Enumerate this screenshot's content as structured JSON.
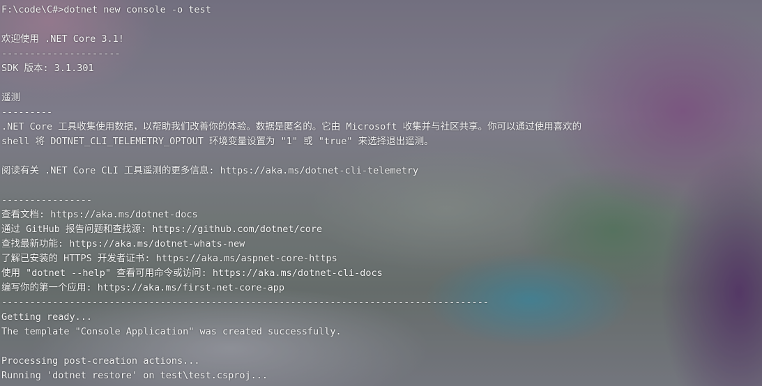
{
  "terminal": {
    "lines": [
      "F:\\code\\C#>dotnet new console -o test",
      "",
      "欢迎使用 .NET Core 3.1!",
      "---------------------",
      "SDK 版本: 3.1.301",
      "",
      "遥测",
      "---------",
      ".NET Core 工具收集使用数据，以帮助我们改善你的体验。数据是匿名的。它由 Microsoft 收集并与社区共享。你可以通过使用喜欢的",
      "shell 将 DOTNET_CLI_TELEMETRY_OPTOUT 环境变量设置为 \"1\" 或 \"true\" 来选择退出遥测。",
      "",
      "阅读有关 .NET Core CLI 工具遥测的更多信息: https://aka.ms/dotnet-cli-telemetry",
      "",
      "----------------",
      "查看文档: https://aka.ms/dotnet-docs",
      "通过 GitHub 报告问题和查找源: https://github.com/dotnet/core",
      "查找最新功能: https://aka.ms/dotnet-whats-new",
      "了解已安装的 HTTPS 开发者证书: https://aka.ms/aspnet-core-https",
      "使用 \"dotnet --help\" 查看可用命令或访问: https://aka.ms/dotnet-cli-docs",
      "编写你的第一个应用: https://aka.ms/first-net-core-app",
      "--------------------------------------------------------------------------------------",
      "Getting ready...",
      "The template \"Console Application\" was created successfully.",
      "",
      "Processing post-creation actions...",
      "Running 'dotnet restore' on test\\test.csproj..."
    ]
  }
}
